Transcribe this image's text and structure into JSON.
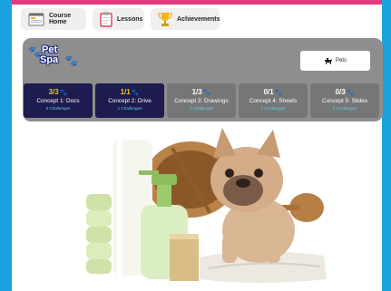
{
  "nav": {
    "course_home": "Course Home",
    "lessons": "Lessons",
    "achievements": "Achievements"
  },
  "logo": {
    "line1": "Pet",
    "line2": "Spa"
  },
  "pets_button": {
    "label": "Pets",
    "icon": "dog-icon"
  },
  "concepts": [
    {
      "score": "3/3",
      "title": "Concept 1: Docs",
      "subtitle": "3 Challenges",
      "completed": true
    },
    {
      "score": "1/1",
      "title": "Concept 2: Drive",
      "subtitle": "1 Challenges",
      "completed": true
    },
    {
      "score": "1/3",
      "title": "Concept 3: Drawings",
      "subtitle": "3 Challenges",
      "completed": false
    },
    {
      "score": "0/1",
      "title": "Concept 4: Sheets",
      "subtitle": "1 Challenges",
      "completed": false
    },
    {
      "score": "0/3",
      "title": "Concept 5: Slides",
      "subtitle": "3 Challenges",
      "completed": false
    }
  ],
  "colors": {
    "top_bar": "#e4397d",
    "side_edges": "#1aa2dd",
    "panel": "#8e8e8e",
    "completed_card": "#1e1b4f",
    "pending_card": "#767676",
    "score_gold": "#f2c81e",
    "subtitle_cyan": "#5dd0f0"
  },
  "icons": [
    "course-home-icon",
    "clipboard-icon",
    "trophy-icon",
    "paw-icon",
    "dog-icon"
  ]
}
